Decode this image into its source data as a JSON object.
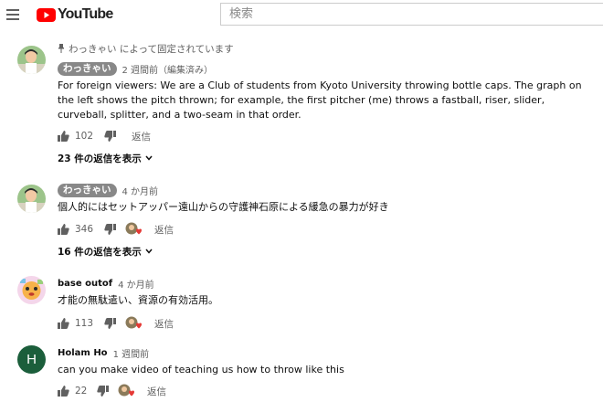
{
  "header": {
    "logo_text": "YouTube",
    "search_placeholder": "検索"
  },
  "comments": [
    {
      "pinned_text": "わっきゃい によって固定されています",
      "author": "わっきゃい",
      "author_chip": true,
      "time": "2 週間前（編集済み）",
      "text": "For foreign viewers: We are a Club of students from Kyoto University throwing bottle caps. The graph on the left shows the pitch thrown; for example, the first pitcher (me) throws a fastball, riser, slider, curveball, splitter, and a two-seam in that order.",
      "likes": "102",
      "reply_label": "返信",
      "replies_label": "23 件の返信を表示"
    },
    {
      "author": "わっきゃい",
      "author_chip": true,
      "time": "4 か月前",
      "text": "個人的にはセットアッパー遠山からの守護神石原による緩急の暴力が好き",
      "likes": "346",
      "reply_label": "返信",
      "replies_label": "16 件の返信を表示"
    },
    {
      "author": "base outof",
      "time": "4 か月前",
      "text": "才能の無駄遣い、資源の有効活用。",
      "likes": "113",
      "reply_label": "返信"
    },
    {
      "author": "Holam Ho",
      "avatar_letter": "H",
      "time": "1 週間前",
      "text": "can you make video of teaching us how to throw like this",
      "likes": "22",
      "reply_label": "返信"
    }
  ],
  "colors": {
    "brand_red": "#ff0000",
    "author_chip_bg": "#888888",
    "avatar_green": "#1b5e3b",
    "heart": "#e53935"
  }
}
